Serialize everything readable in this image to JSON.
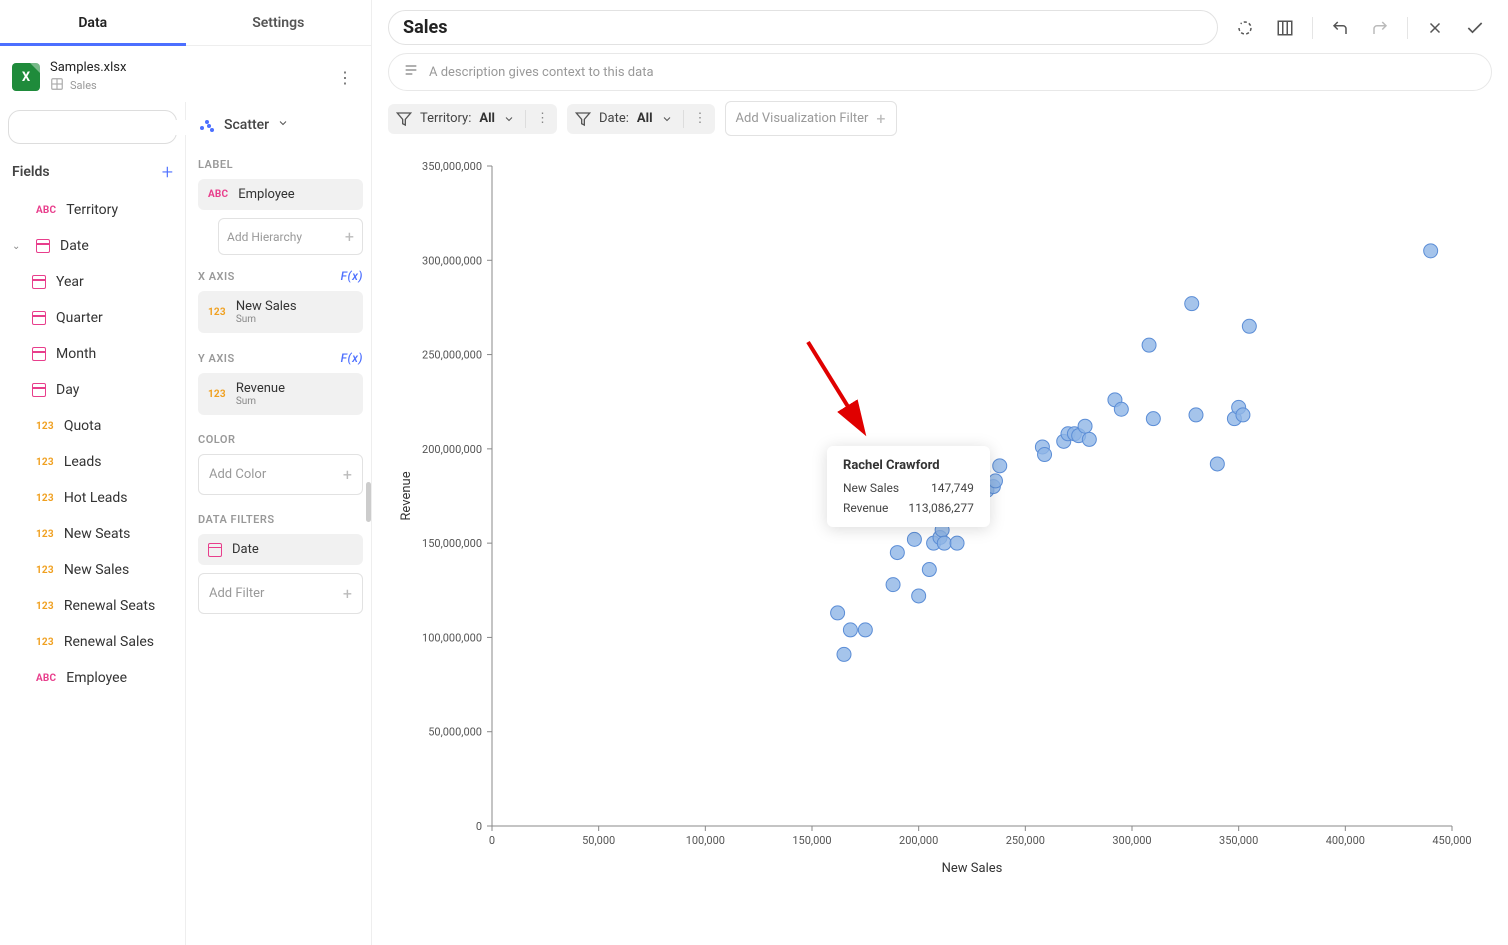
{
  "tabs": {
    "data": "Data",
    "settings": "Settings"
  },
  "file": {
    "name": "Samples.xlsx",
    "sheet": "Sales"
  },
  "fields_header": "Fields",
  "fields": [
    {
      "type": "abc",
      "label": "Territory"
    },
    {
      "type": "cal",
      "label": "Date",
      "expandable": true,
      "children": [
        {
          "type": "cal",
          "label": "Year"
        },
        {
          "type": "cal",
          "label": "Quarter"
        },
        {
          "type": "cal",
          "label": "Month"
        },
        {
          "type": "cal",
          "label": "Day"
        }
      ]
    },
    {
      "type": "num",
      "label": "Quota"
    },
    {
      "type": "num",
      "label": "Leads"
    },
    {
      "type": "num",
      "label": "Hot Leads"
    },
    {
      "type": "num",
      "label": "New Seats"
    },
    {
      "type": "num",
      "label": "New Sales"
    },
    {
      "type": "num",
      "label": "Renewal Seats"
    },
    {
      "type": "num",
      "label": "Renewal Sales"
    },
    {
      "type": "abc",
      "label": "Employee"
    }
  ],
  "config": {
    "chart_type": "Scatter",
    "sections": {
      "label": "LABEL",
      "xaxis": "X AXIS",
      "yaxis": "Y AXIS",
      "color": "COLOR",
      "datafilters": "DATA FILTERS"
    },
    "fx": "F(x)",
    "label_chip": {
      "type": "abc",
      "text": "Employee"
    },
    "add_hierarchy": "Add Hierarchy",
    "x_chip": {
      "type": "num",
      "text": "New Sales",
      "sub": "Sum"
    },
    "y_chip": {
      "type": "num",
      "text": "Revenue",
      "sub": "Sum"
    },
    "add_color": "Add Color",
    "filter_chip": {
      "type": "cal",
      "text": "Date"
    },
    "add_filter": "Add Filter"
  },
  "viz": {
    "title": "Sales",
    "description_placeholder": "A description gives context to this data",
    "filters": [
      {
        "field": "Territory",
        "value": "All"
      },
      {
        "field": "Date",
        "value": "All"
      }
    ],
    "add_filter_btn": "Add Visualization Filter"
  },
  "chart_data": {
    "type": "scatter",
    "xlabel": "New Sales",
    "ylabel": "Revenue",
    "xlim": [
      0,
      450000
    ],
    "ylim": [
      0,
      350000000
    ],
    "xticks": [
      0,
      50000,
      100000,
      150000,
      200000,
      250000,
      300000,
      350000,
      400000,
      450000
    ],
    "yticks": [
      0,
      50000000,
      100000000,
      150000000,
      200000000,
      250000000,
      300000000,
      350000000
    ],
    "xtick_labels": [
      "0",
      "50,000",
      "100,000",
      "150,000",
      "200,000",
      "250,000",
      "300,000",
      "350,000",
      "400,000",
      "450,000"
    ],
    "ytick_labels": [
      "0",
      "50,000,000",
      "100,000,000",
      "150,000,000",
      "200,000,000",
      "250,000,000",
      "300,000,000",
      "350,000,000"
    ],
    "points": [
      {
        "x": 162000,
        "y": 113000000
      },
      {
        "x": 165000,
        "y": 91000000
      },
      {
        "x": 168000,
        "y": 104000000
      },
      {
        "x": 175000,
        "y": 104000000
      },
      {
        "x": 188000,
        "y": 128000000
      },
      {
        "x": 190000,
        "y": 145000000
      },
      {
        "x": 198000,
        "y": 152000000
      },
      {
        "x": 200000,
        "y": 122000000
      },
      {
        "x": 205000,
        "y": 136000000
      },
      {
        "x": 207000,
        "y": 150000000
      },
      {
        "x": 210000,
        "y": 153000000
      },
      {
        "x": 211000,
        "y": 157000000
      },
      {
        "x": 212000,
        "y": 150000000
      },
      {
        "x": 218000,
        "y": 150000000
      },
      {
        "x": 220000,
        "y": 183000000
      },
      {
        "x": 225000,
        "y": 191000000
      },
      {
        "x": 230000,
        "y": 188000000
      },
      {
        "x": 232000,
        "y": 178000000
      },
      {
        "x": 235000,
        "y": 180000000
      },
      {
        "x": 236000,
        "y": 183000000
      },
      {
        "x": 238000,
        "y": 191000000
      },
      {
        "x": 258000,
        "y": 201000000
      },
      {
        "x": 259000,
        "y": 197000000
      },
      {
        "x": 268000,
        "y": 204000000
      },
      {
        "x": 270000,
        "y": 208000000
      },
      {
        "x": 273000,
        "y": 208000000
      },
      {
        "x": 275000,
        "y": 207000000
      },
      {
        "x": 278000,
        "y": 212000000
      },
      {
        "x": 280000,
        "y": 205000000
      },
      {
        "x": 292000,
        "y": 226000000
      },
      {
        "x": 295000,
        "y": 221000000
      },
      {
        "x": 310000,
        "y": 216000000
      },
      {
        "x": 330000,
        "y": 218000000
      },
      {
        "x": 340000,
        "y": 192000000
      },
      {
        "x": 348000,
        "y": 216000000
      },
      {
        "x": 350000,
        "y": 222000000
      },
      {
        "x": 352000,
        "y": 218000000
      },
      {
        "x": 308000,
        "y": 255000000
      },
      {
        "x": 328000,
        "y": 277000000
      },
      {
        "x": 355000,
        "y": 265000000
      },
      {
        "x": 440000,
        "y": 305000000
      }
    ],
    "tooltip": {
      "title": "Rachel Crawford",
      "rows": [
        {
          "k": "New Sales",
          "v": "147,749"
        },
        {
          "k": "Revenue",
          "v": "113,086,277"
        }
      ]
    }
  }
}
